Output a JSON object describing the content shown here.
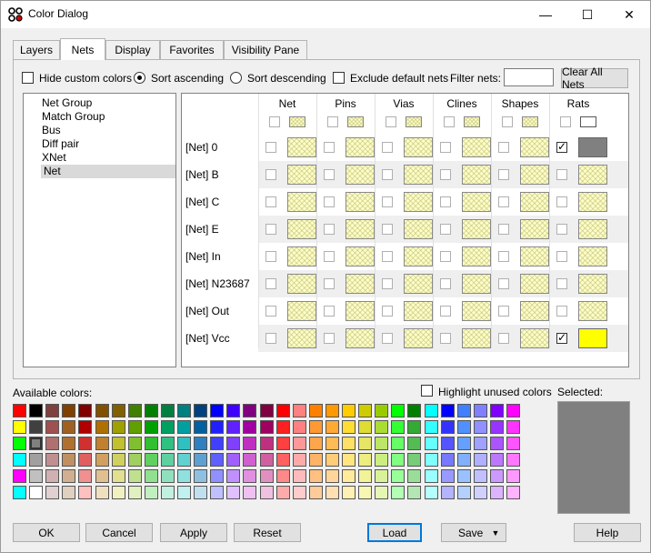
{
  "window": {
    "title": "Color Dialog",
    "minimize": "—",
    "maximize": "☐",
    "close": "✕"
  },
  "tabs": [
    "Layers",
    "Nets",
    "Display",
    "Favorites",
    "Visibility Pane"
  ],
  "options": {
    "hide_custom_colors": "Hide custom colors",
    "sort_ascending": "Sort ascending",
    "sort_descending": "Sort descending",
    "exclude_default_nets": "Exclude default nets",
    "filter_nets_label": "Filter nets:",
    "filter_nets_value": "",
    "clear_all_nets": "Clear All Nets"
  },
  "groups": [
    "Net Group",
    "Match Group",
    "Bus",
    "Diff pair",
    "XNet",
    "Net"
  ],
  "selected_group": "Net",
  "columns": [
    "Net",
    "Pins",
    "Vias",
    "Clines",
    "Shapes",
    "Rats"
  ],
  "rows": [
    {
      "label": "[Net] 0",
      "rats_checked": true,
      "rats_color": "#808080"
    },
    {
      "label": "[Net] B",
      "rats_checked": false,
      "rats_color": ""
    },
    {
      "label": "[Net] C",
      "rats_checked": false,
      "rats_color": ""
    },
    {
      "label": "[Net] E",
      "rats_checked": false,
      "rats_color": ""
    },
    {
      "label": "[Net] In",
      "rats_checked": false,
      "rats_color": ""
    },
    {
      "label": "[Net] N23687",
      "rats_checked": false,
      "rats_color": ""
    },
    {
      "label": "[Net] Out",
      "rats_checked": false,
      "rats_color": ""
    },
    {
      "label": "[Net] Vcc",
      "rats_checked": true,
      "rats_color": "#ffff00"
    }
  ],
  "palette": {
    "label": "Available colors:",
    "highlight_unused": "Highlight unused colors",
    "selected_label": "Selected:",
    "selected_color": "#808080",
    "selected_index": [
      2,
      1
    ],
    "rows": [
      [
        "#ff0000",
        "#000000",
        "#804040",
        "#804000",
        "#800000",
        "#805000",
        "#806000",
        "#408000",
        "#008000",
        "#008040",
        "#008080",
        "#004080",
        "#0000ff",
        "#4000ff",
        "#800080",
        "#800040",
        "#ff0000",
        "#ff8080",
        "#ff8000",
        "#ff9900",
        "#ffcc00",
        "#cccc00",
        "#99cc00",
        "#00ff00",
        "#008000",
        "#00ffff",
        "#0000ff",
        "#4080ff",
        "#8080ff",
        "#8000ff",
        "#ff00ff"
      ],
      [
        "#ffff00",
        "#404040",
        "#a05050",
        "#a06020",
        "#b00000",
        "#b07000",
        "#a0a000",
        "#60a000",
        "#00a000",
        "#00a060",
        "#00a0a0",
        "#0060a0",
        "#2020ff",
        "#6020ff",
        "#a000a0",
        "#a00060",
        "#ff2020",
        "#ff8080",
        "#ff9933",
        "#ffaa33",
        "#ffdd33",
        "#dddd33",
        "#aadd33",
        "#33ff33",
        "#33aa33",
        "#33ffff",
        "#3333ff",
        "#5090ff",
        "#9090ff",
        "#9933ff",
        "#ff33ff"
      ],
      [
        "#00ff00",
        "#808080",
        "#b07070",
        "#b07030",
        "#d03030",
        "#c08030",
        "#c0c030",
        "#80c030",
        "#30c030",
        "#30c080",
        "#30c0c0",
        "#3080c0",
        "#4040ff",
        "#8040ff",
        "#c030c0",
        "#c03080",
        "#ff4040",
        "#ff9999",
        "#ffa64d",
        "#ffbb55",
        "#ffe066",
        "#e6e666",
        "#bbe666",
        "#66ff66",
        "#55bb55",
        "#66ffff",
        "#5555ff",
        "#66a0ff",
        "#a0a0ff",
        "#aa55ff",
        "#ff55ff"
      ],
      [
        "#00ffff",
        "#a0a0a0",
        "#c09090",
        "#c09060",
        "#e06060",
        "#d0a060",
        "#d0d060",
        "#a0d060",
        "#60d060",
        "#60d0a0",
        "#60d0d0",
        "#60a0d0",
        "#6060ff",
        "#a060ff",
        "#d060d0",
        "#d060a0",
        "#ff6060",
        "#ffaaaa",
        "#ffb366",
        "#ffcc77",
        "#ffe680",
        "#eeee80",
        "#ccee80",
        "#80ff80",
        "#77cc77",
        "#80ffff",
        "#7777ff",
        "#80b0ff",
        "#b0b0ff",
        "#bb77ff",
        "#ff77ff"
      ],
      [
        "#ff00ff",
        "#c0c0c0",
        "#d0b0b0",
        "#d0b090",
        "#f09090",
        "#e0c090",
        "#e0e090",
        "#c0e090",
        "#90e090",
        "#90e0c0",
        "#90e0e0",
        "#90c0e0",
        "#9090ff",
        "#c090ff",
        "#e090e0",
        "#e090c0",
        "#ff8888",
        "#ffbbbb",
        "#ffc080",
        "#ffd699",
        "#ffeb99",
        "#f2f299",
        "#d9f299",
        "#99ff99",
        "#99dd99",
        "#99ffff",
        "#9999ff",
        "#99c0ff",
        "#c0c0ff",
        "#cc99ff",
        "#ff99ff"
      ],
      [
        "#00ffff",
        "#ffffff",
        "#e0d0d0",
        "#e0d0c0",
        "#ffc0c0",
        "#f0e0c0",
        "#f0f0c0",
        "#e0f0c0",
        "#c0f0c0",
        "#c0f0e0",
        "#c0f0f0",
        "#c0e0f0",
        "#c0c0ff",
        "#e0c0ff",
        "#f0c0f0",
        "#f0c0e0",
        "#ffaaaa",
        "#ffcccc",
        "#ffcc99",
        "#ffe0b3",
        "#fff0b3",
        "#f7f7b3",
        "#e6f7b3",
        "#b3ffb3",
        "#b3e6b3",
        "#b3ffff",
        "#b3b3ff",
        "#b3d0ff",
        "#d0d0ff",
        "#ddb3ff",
        "#ffb3ff"
      ]
    ]
  },
  "buttons": {
    "ok": "OK",
    "cancel": "Cancel",
    "apply": "Apply",
    "reset": "Reset",
    "load": "Load",
    "save": "Save",
    "help": "Help"
  }
}
